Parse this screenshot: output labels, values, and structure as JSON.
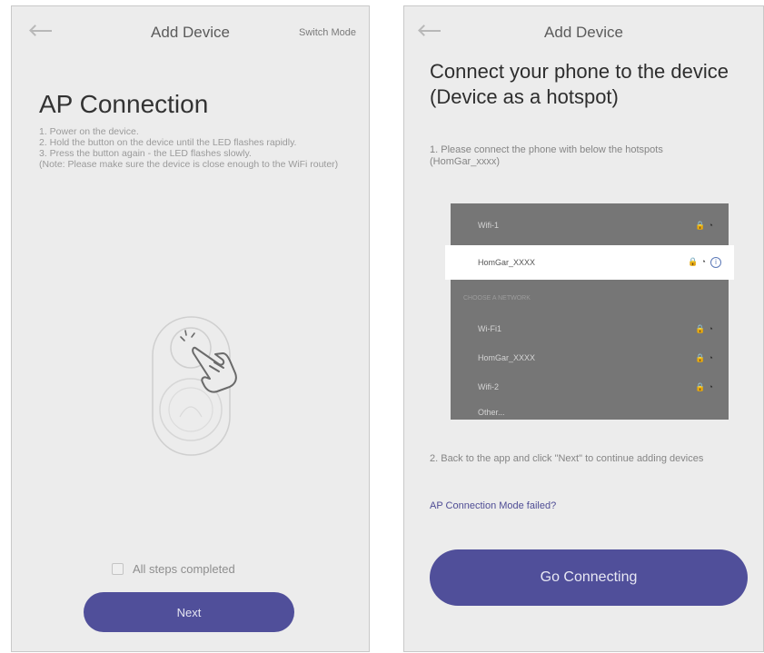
{
  "left_screen": {
    "nav_title": "Add Device",
    "switch_mode_label": "Switch Mode",
    "heading": "AP Connection",
    "steps": [
      "1. Power on the device.",
      "2. Hold the button on the device until the LED flashes rapidly.",
      "3. Press the button again - the LED flashes slowly.",
      "(Note: Please make sure the device is close enough to the WiFi router)"
    ],
    "all_steps_completed_label": "All steps completed",
    "next_button_label": "Next"
  },
  "right_screen": {
    "nav_title": "Add Device",
    "heading": "Connect your phone to the device (Device as a hotspot)",
    "step1": "1. Please connect the phone with below the hotspots (HomGar_xxxx)",
    "wifi_list": {
      "top_network": "Wifi-1",
      "highlighted_network": "HomGar_XXXX",
      "section_label": "CHOOSE A NETWORK",
      "networks": [
        "Wi-Fi1",
        "HomGar_XXXX",
        "Wifi-2"
      ],
      "other_label": "Other..."
    },
    "step2": "2. Back to the app and click \"Next\" to continue adding devices",
    "ap_failed_link": "AP Connection Mode failed?",
    "go_connecting_label": "Go Connecting"
  },
  "colors": {
    "primary_button": "#504f9a",
    "link": "#4f4d95",
    "screen_background": "#ececec",
    "wifi_panel": "#767676"
  },
  "icons": [
    "back-arrow-icon",
    "hand-pointer-icon",
    "lock-icon",
    "wifi-icon",
    "info-icon"
  ]
}
